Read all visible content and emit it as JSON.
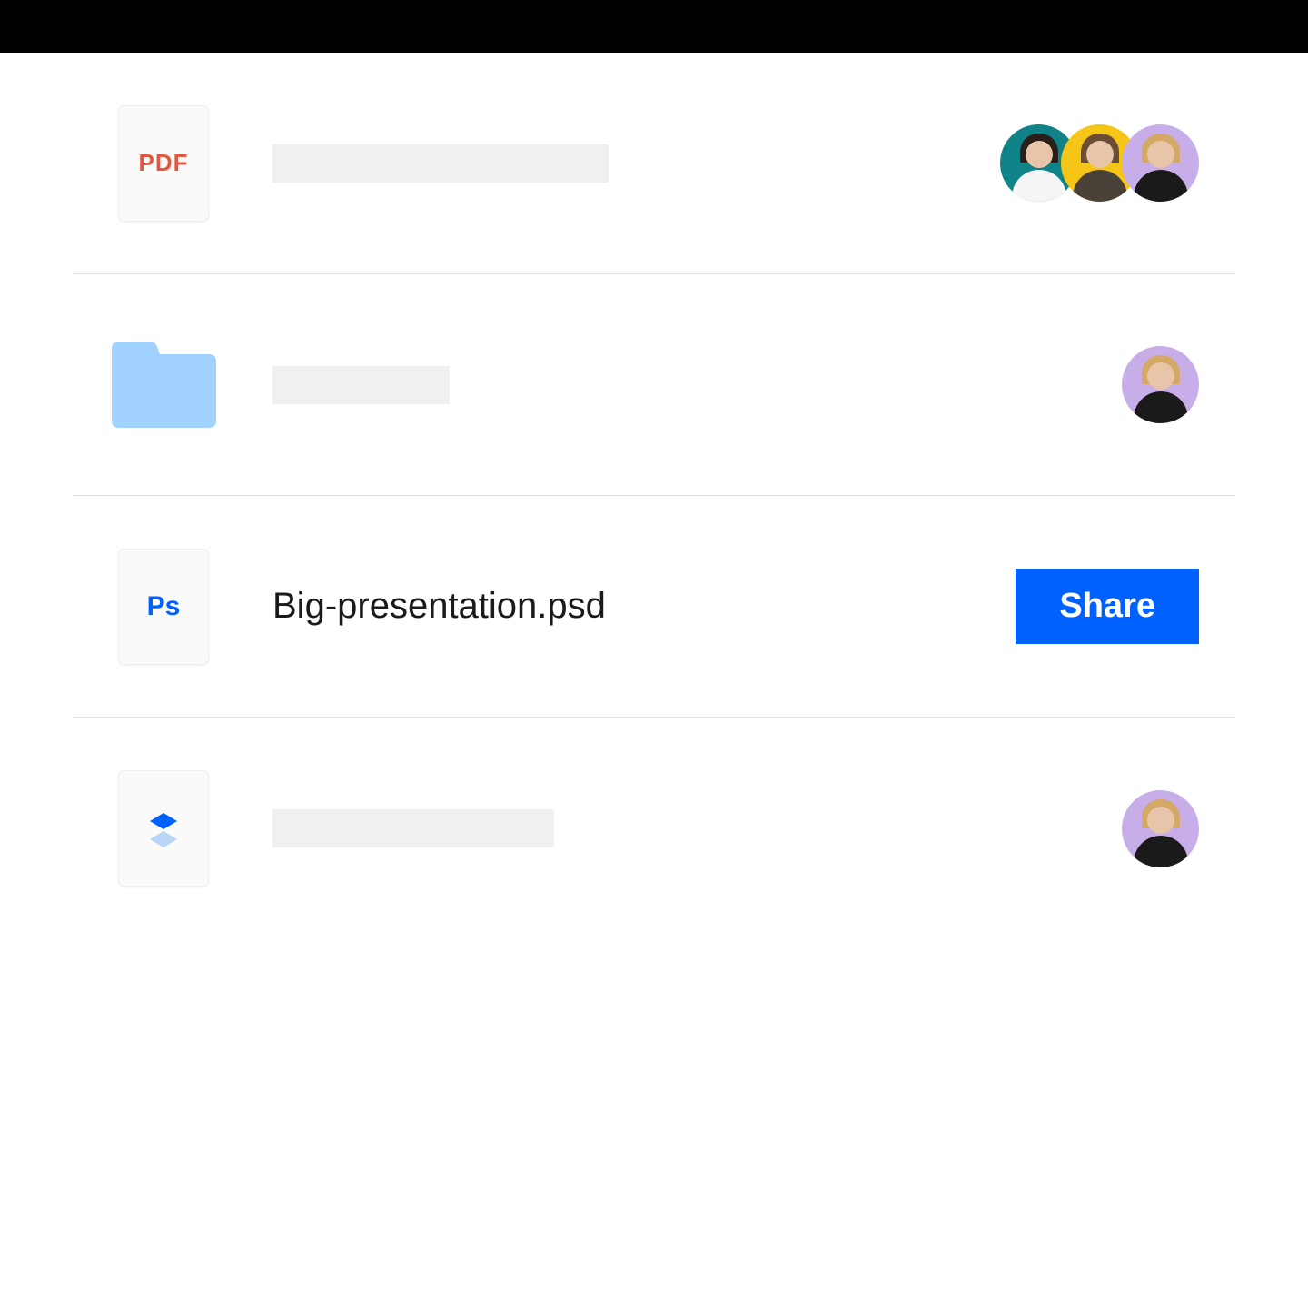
{
  "rows": [
    {
      "type": "file",
      "icon_label": "PDF",
      "name": "",
      "name_placeholder": true,
      "placeholder_width": "w1",
      "avatars": [
        "teal",
        "yellow",
        "purple"
      ],
      "action": null
    },
    {
      "type": "folder",
      "icon_label": "",
      "name": "",
      "name_placeholder": true,
      "placeholder_width": "w2",
      "avatars": [
        "purple"
      ],
      "action": null
    },
    {
      "type": "file",
      "icon_label": "Ps",
      "name": "Big-presentation.psd",
      "name_placeholder": false,
      "avatars": [],
      "action": "Share"
    },
    {
      "type": "dropbox",
      "icon_label": "",
      "name": "",
      "name_placeholder": true,
      "placeholder_width": "w3",
      "avatars": [
        "purple"
      ],
      "action": null
    }
  ],
  "colors": {
    "accent": "#0061ff",
    "pdf_red": "#e8543b",
    "folder_blue": "#a0d1ff",
    "avatar_teal": "#0f8387",
    "avatar_yellow": "#f5c518",
    "avatar_purple": "#c7aee8"
  }
}
